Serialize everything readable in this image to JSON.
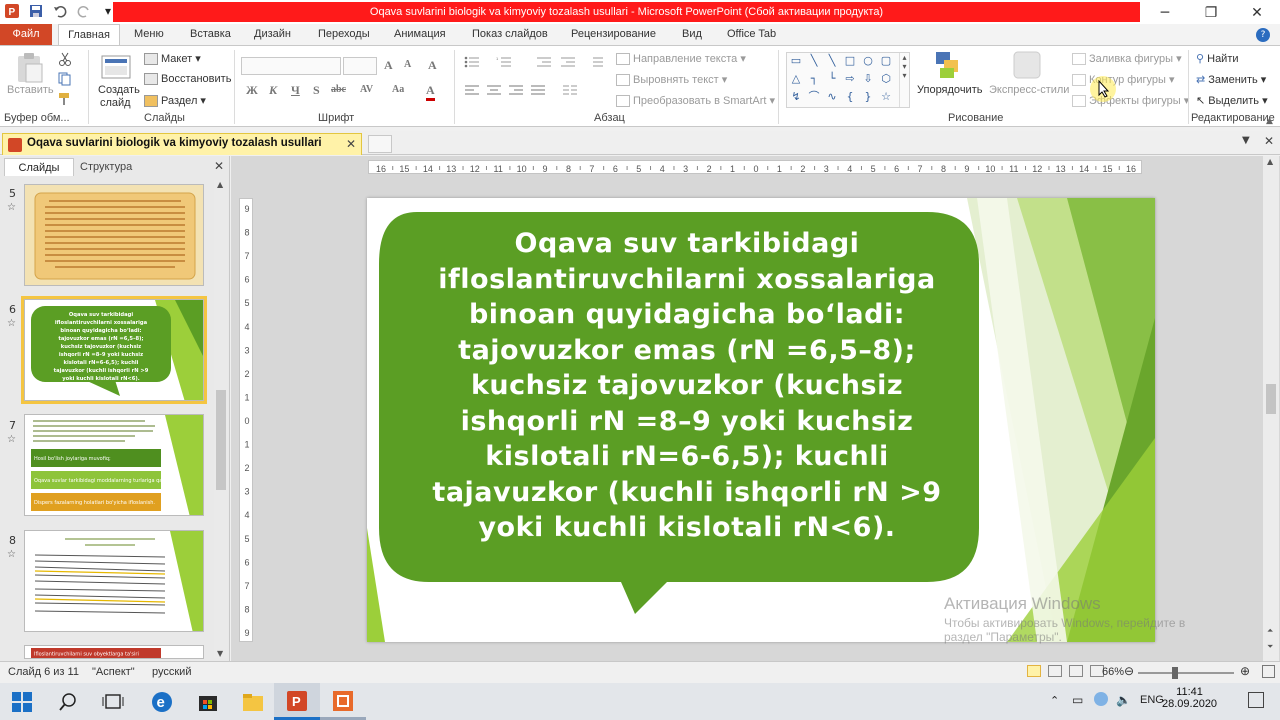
{
  "window": {
    "title": "Oqava suvlarini biologik va kimyoviy tozalash usullari  -  Microsoft PowerPoint (Сбой активации продукта)"
  },
  "ribbon_tabs": [
    "Файл",
    "Главная",
    "Меню",
    "Вставка",
    "Дизайн",
    "Переходы",
    "Анимация",
    "Показ слайдов",
    "Рецензирование",
    "Вид",
    "Office Tab"
  ],
  "ribbon": {
    "clipboard": {
      "paste": "Вставить",
      "label": "Буфер обм..."
    },
    "slides": {
      "new_slide_1": "Создать",
      "new_slide_2": "слайд",
      "layout": "Макет",
      "reset": "Восстановить",
      "section": "Раздел",
      "label": "Слайды"
    },
    "font": {
      "label": "Шрифт",
      "bold": "Ж",
      "italic": "К",
      "underline": "Ч",
      "shadow": "S",
      "strike": "abc",
      "spacing": "AV",
      "case": "Aa",
      "color": "A"
    },
    "paragraph": {
      "label": "Абзац",
      "text_direction": "Направление текста",
      "align_text": "Выровнять текст",
      "smartart": "Преобразовать в SmartArt"
    },
    "drawing": {
      "arrange": "Упорядочить",
      "quick_styles": "Экспресс-стили",
      "fill": "Заливка фигуры",
      "outline": "Контур фигуры",
      "effects": "Эффекты фигуры",
      "label": "Рисование"
    },
    "editing": {
      "find": "Найти",
      "replace": "Заменить",
      "select": "Выделить",
      "label": "Редактирование"
    }
  },
  "doc_tab": {
    "title": "Oqava suvlarini biologik va kimyoviy tozalash usullari"
  },
  "panel": {
    "tab_slides": "Слайды",
    "tab_outline": "Структура",
    "slide_numbers": [
      "5",
      "6",
      "7",
      "8"
    ],
    "thumb7_boxes": [
      "Hosil bo'lish joylariga muvofiq;",
      "Oqava suvlar tarkibidagi moddalarning turlariga qarab;",
      "Dispers fazalarning holatlari bo'yicha ifloslanish."
    ],
    "thumb9_header": "Ifloslantiruvchilarni suv obyektlarga ta'siri"
  },
  "ruler": {
    "h_ticks": [
      "16",
      "15",
      "14",
      "13",
      "12",
      "11",
      "10",
      "9",
      "8",
      "7",
      "6",
      "5",
      "4",
      "3",
      "2",
      "1",
      "0",
      "1",
      "2",
      "3",
      "4",
      "5",
      "6",
      "7",
      "8",
      "9",
      "10",
      "11",
      "12",
      "13",
      "14",
      "15",
      "16"
    ],
    "v_ticks": [
      "9",
      "8",
      "7",
      "6",
      "5",
      "4",
      "3",
      "2",
      "1",
      "0",
      "1",
      "2",
      "3",
      "4",
      "5",
      "6",
      "7",
      "8",
      "9"
    ]
  },
  "slide": {
    "lines": [
      "Oqava suv tarkibidagi",
      "ifloslantiruvchilarni xossalariga",
      "binoan quyidagicha bo‘ladi:",
      "tajovuzkor emas  (rN =6,5–8);",
      "kuchsiz  tajovuzkor (kuchsiz",
      "ishqorli rN =8–9 yoki kuchsiz",
      "kislotali rN=6-6,5); kuchli",
      "tajavuzkor (kuchli  ishqorli rN >9",
      "yoki  kuchli  kislotali  rN<6)."
    ],
    "bubble_color": "#5b9e24",
    "accent_light": "#9ccf3a"
  },
  "watermark": {
    "title": "Активация Windows",
    "subtitle": "Чтобы активировать Windows, перейдите в",
    "subtitle2": "раздел \"Параметры\"."
  },
  "status": {
    "slide_info": "Слайд 6 из 11",
    "theme": "\"Аспект\"",
    "language": "русский",
    "zoom": "66%"
  },
  "taskbar": {
    "lang": "ENG",
    "time": "11:41",
    "date": "28.09.2020"
  }
}
